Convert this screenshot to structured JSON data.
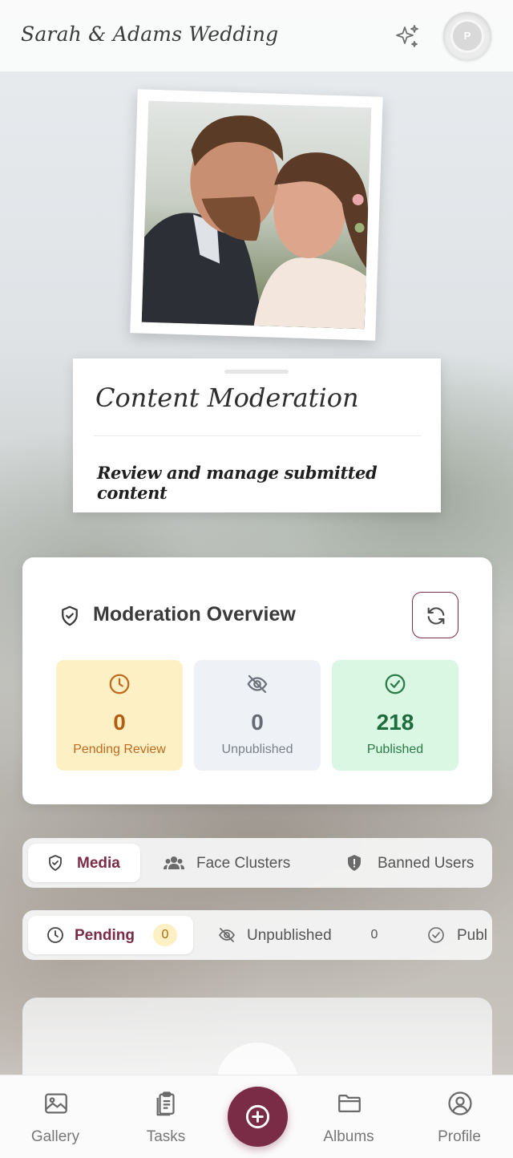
{
  "header": {
    "title": "Sarah & Adams Wedding",
    "avatar_initial": "P"
  },
  "hero": {
    "title": "Content Moderation",
    "subtitle": "Review and manage submitted content"
  },
  "overview": {
    "title": "Moderation Overview",
    "stats": [
      {
        "value": "0",
        "label": "Pending Review",
        "icon": "clock-icon"
      },
      {
        "value": "0",
        "label": "Unpublished",
        "icon": "eye-off-icon"
      },
      {
        "value": "218",
        "label": "Published",
        "icon": "check-circle-icon"
      }
    ]
  },
  "tabs": [
    {
      "label": "Media",
      "icon": "shield-check-icon",
      "active": true
    },
    {
      "label": "Face Clusters",
      "icon": "users-icon",
      "active": false
    },
    {
      "label": "Banned Users",
      "icon": "shield-alert-icon",
      "active": false
    }
  ],
  "filters": [
    {
      "label": "Pending",
      "count": "0",
      "icon": "clock-icon",
      "active": true
    },
    {
      "label": "Unpublished",
      "count": "0",
      "icon": "eye-off-icon",
      "active": false
    },
    {
      "label": "Publ",
      "icon": "check-circle-icon",
      "active": false
    }
  ],
  "bottom_nav": [
    {
      "label": "Gallery",
      "icon": "image-icon"
    },
    {
      "label": "Tasks",
      "icon": "clipboard-icon"
    },
    {
      "label": "",
      "icon": "plus-icon"
    },
    {
      "label": "Albums",
      "icon": "folder-icon"
    },
    {
      "label": "Profile",
      "icon": "user-circle-icon"
    }
  ],
  "colors": {
    "accent": "#7a2b45",
    "pending_bg": "#fdf0c4",
    "unpublished_bg": "#eef1f6",
    "published_bg": "#d9f7e2"
  }
}
